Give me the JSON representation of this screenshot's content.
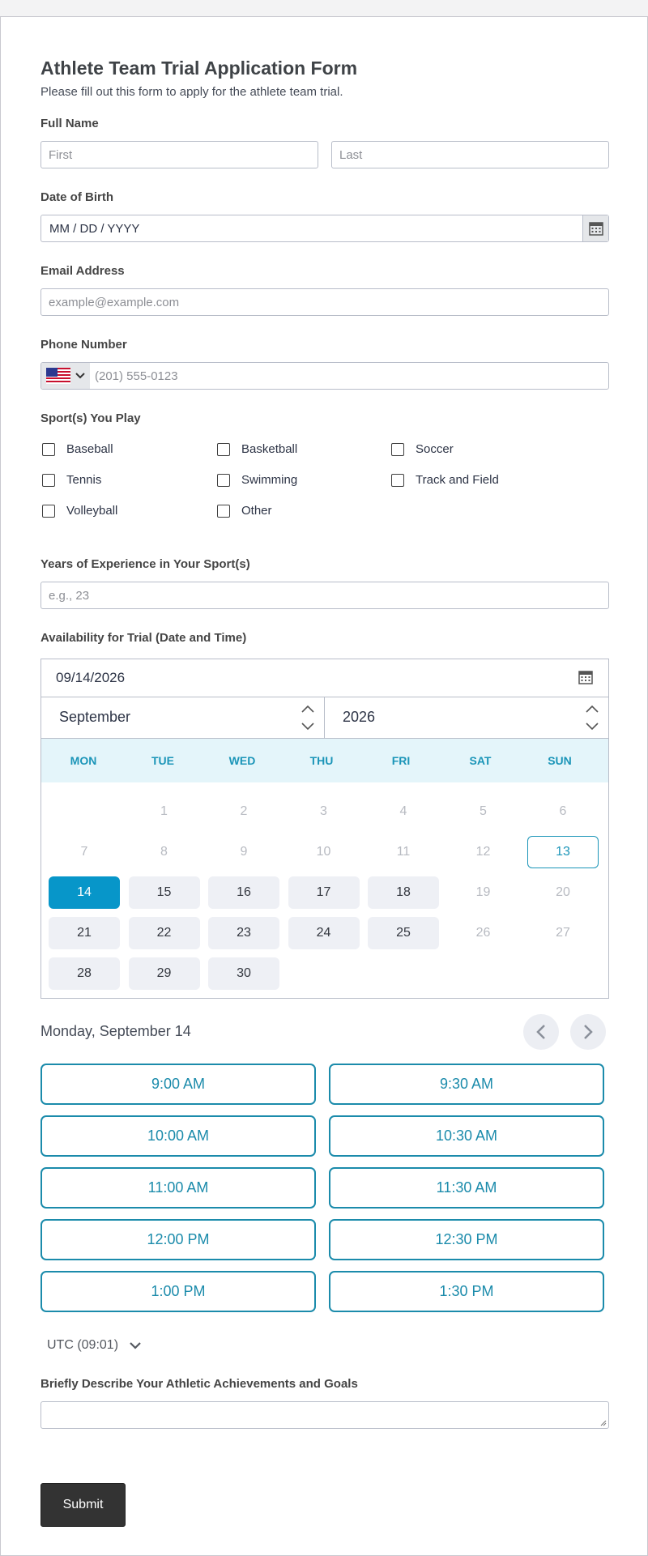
{
  "form": {
    "title": "Athlete Team Trial Application Form",
    "subtitle": "Please fill out this form to apply for the athlete team trial."
  },
  "full_name": {
    "label": "Full Name",
    "first_placeholder": "First",
    "last_placeholder": "Last"
  },
  "dob": {
    "label": "Date of Birth",
    "placeholder": "MM / DD / YYYY",
    "icon": "calendar-icon"
  },
  "email": {
    "label": "Email Address",
    "placeholder": "example@example.com"
  },
  "phone": {
    "label": "Phone Number",
    "country_flag": "us-flag-icon",
    "placeholder": "(201) 555-0123"
  },
  "sports": {
    "label": "Sport(s) You Play",
    "options": [
      "Baseball",
      "Basketball",
      "Soccer",
      "Tennis",
      "Swimming",
      "Track and Field",
      "Volleyball",
      "Other"
    ]
  },
  "experience": {
    "label": "Years of Experience in Your Sport(s)",
    "placeholder": "e.g., 23"
  },
  "availability": {
    "label": "Availability for Trial (Date and Time)",
    "date_value": "09/14/2026",
    "month": "September",
    "year": "2026",
    "weekdays": [
      "MON",
      "TUE",
      "WED",
      "THU",
      "FRI",
      "SAT",
      "SUN"
    ],
    "weeks": [
      [
        "",
        "1",
        "2",
        "3",
        "4",
        "5",
        "6"
      ],
      [
        "7",
        "8",
        "9",
        "10",
        "11",
        "12",
        "13"
      ],
      [
        "14",
        "15",
        "16",
        "17",
        "18",
        "19",
        "20"
      ],
      [
        "21",
        "22",
        "23",
        "24",
        "25",
        "26",
        "27"
      ],
      [
        "28",
        "29",
        "30",
        "",
        "",
        "",
        ""
      ]
    ],
    "today": "13",
    "selected": "14",
    "available": [
      "14",
      "15",
      "16",
      "17",
      "18",
      "21",
      "22",
      "23",
      "24",
      "25",
      "28",
      "29",
      "30"
    ],
    "selected_date_text": "Monday, September 14",
    "time_slots": [
      "9:00 AM",
      "9:30 AM",
      "10:00 AM",
      "10:30 AM",
      "11:00 AM",
      "11:30 AM",
      "12:00 PM",
      "12:30 PM",
      "1:00 PM",
      "1:30 PM"
    ],
    "timezone": "UTC (09:01)",
    "accent_color": "#1b95b8",
    "selected_color": "#0796c9"
  },
  "achievements": {
    "label": "Briefly Describe Your Athletic Achievements and Goals"
  },
  "submit": {
    "label": "Submit"
  }
}
